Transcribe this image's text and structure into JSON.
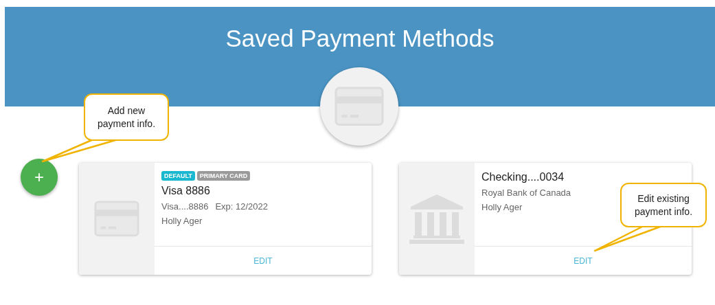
{
  "header": {
    "title": "Saved Payment Methods"
  },
  "add_button": {
    "label": "+"
  },
  "cards": [
    {
      "kind": "card",
      "badges": [
        {
          "label": "DEFAULT",
          "color": "#1ab8d0"
        },
        {
          "label": "PRIMARY CARD",
          "color": "#9a9a9a"
        }
      ],
      "name": "Visa 8886",
      "details": [
        "Visa....8886",
        "Exp: 12/2022"
      ],
      "holder": "Holly Ager",
      "action": "EDIT"
    },
    {
      "kind": "bank",
      "name": "Checking....0034",
      "details": [
        "Royal Bank of Canada"
      ],
      "holder": "Holly Ager",
      "action": "EDIT"
    }
  ],
  "callouts": [
    {
      "text": "Add new payment info."
    },
    {
      "text": "Edit existing payment info."
    }
  ]
}
